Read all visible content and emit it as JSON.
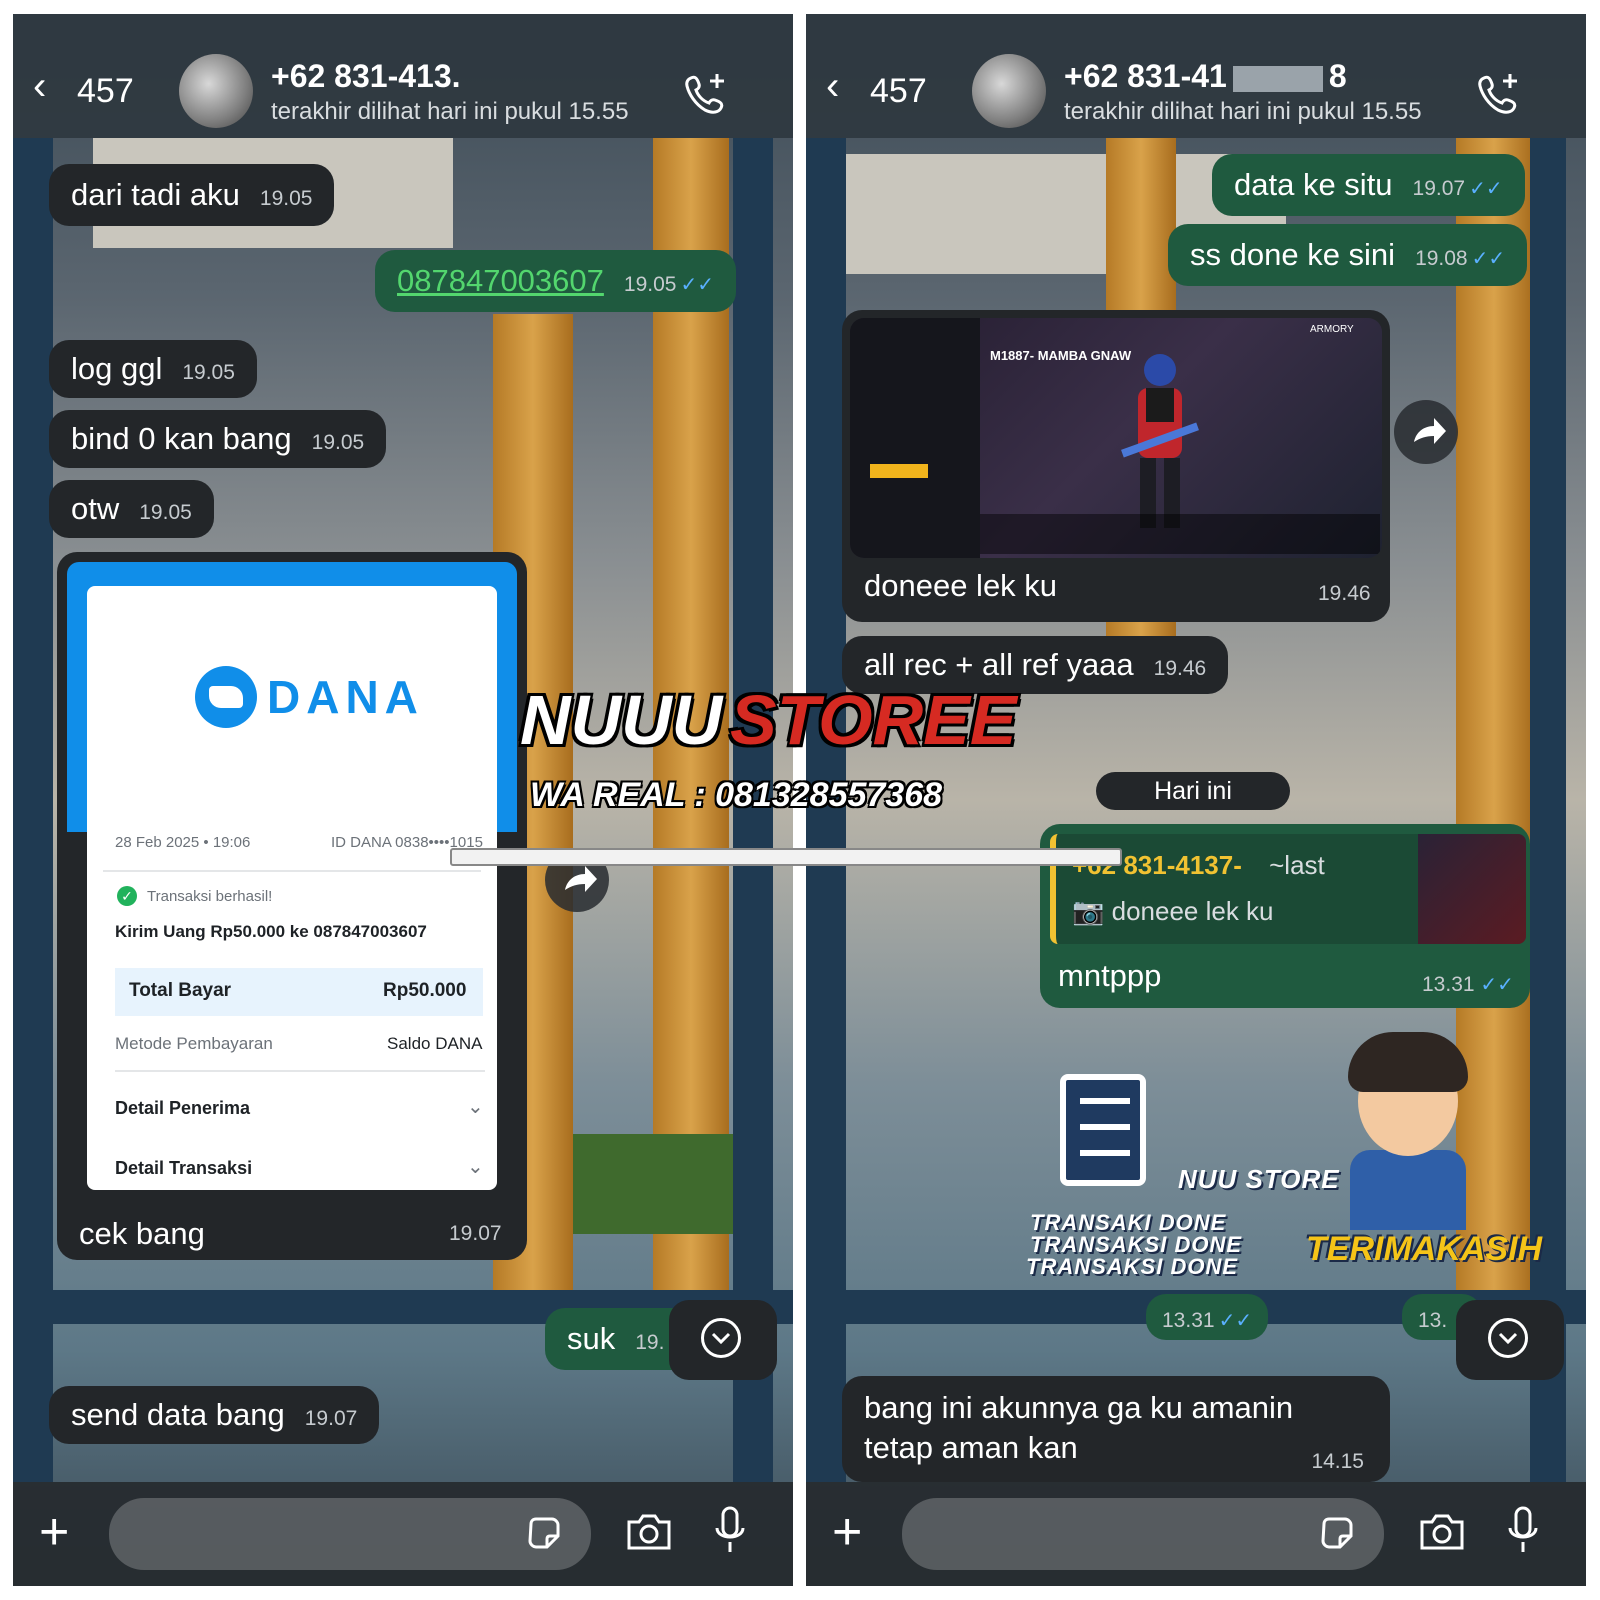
{
  "left_chat": {
    "header": {
      "back_count": "457",
      "contact_name": "+62 831-413.",
      "last_seen": "terakhir dilihat hari ini pukul 15.55"
    },
    "messages": [
      {
        "text": "dari tadi aku",
        "time": "19.05"
      },
      {
        "text": "087847003607",
        "time": "19.05"
      },
      {
        "text": "log ggl",
        "time": "19.05"
      },
      {
        "text": "bind 0 kan bang",
        "time": "19.05"
      },
      {
        "text": "otw",
        "time": "19.05"
      },
      {
        "text": "cek bang",
        "time": "19.07"
      },
      {
        "text": "suk",
        "time": "19."
      },
      {
        "text": "send data bang",
        "time": "19.07"
      }
    ],
    "receipt": {
      "brand": "DANA",
      "date": "28 Feb 2025 • 19:06",
      "dana_id": "ID DANA 0838••••1015",
      "status": "Transaksi berhasil!",
      "description": "Kirim Uang Rp50.000 ke 087847003607",
      "total_label": "Total Bayar",
      "total_value": "Rp50.000",
      "method_label": "Metode Pembayaran",
      "method_value": "Saldo DANA",
      "detail_receiver": "Detail Penerima",
      "detail_transaction": "Detail Transaksi"
    }
  },
  "right_chat": {
    "header": {
      "back_count": "457",
      "contact_name": "+62 831-41",
      "contact_name_end": "8",
      "last_seen": "terakhir dilihat hari ini pukul 15.55"
    },
    "messages": [
      {
        "text": "data ke situ",
        "time": "19.07"
      },
      {
        "text": "ss done ke sini",
        "time": "19.08"
      },
      {
        "text": "doneee lek ku",
        "time": "19.46"
      },
      {
        "text": "all rec + all ref yaaa",
        "time": "19.46"
      },
      {
        "text": "mntppp",
        "time": "13.31"
      },
      {
        "text": "13.31"
      },
      {
        "text": "13."
      },
      {
        "text": "bang ini akunnya ga ku amanin tetap aman kan",
        "time": "14.15"
      }
    ],
    "game_title": "M1887- MAMBA GNAW",
    "game_armory": "ARMORY",
    "day_separator": "Hari ini",
    "quote": {
      "author": "+62 831-4137-",
      "author_tail": "~last",
      "text": "doneee lek ku"
    },
    "sticker": {
      "line1": "TRANSAKI DONE",
      "line2": "TRANSAKSI DONE",
      "line3": "TRANSAKSI DONE",
      "thanks": "TERIMAKASIH",
      "brand": "NUU STORE"
    }
  },
  "watermark": {
    "title_part1": "NUUU",
    "title_part2": "STOREE",
    "subtitle": "WA REAL : 081328557368"
  },
  "icons": {
    "back": "chevron-left-icon",
    "call": "phone-plus-icon",
    "plus": "plus-icon",
    "sticker": "sticker-icon",
    "camera": "camera-icon",
    "mic": "microphone-icon",
    "forward": "forward-icon",
    "scroll": "chevron-down-icon"
  },
  "colors": {
    "incoming_bubble": "#232629",
    "outgoing_bubble": "#1f5a3f",
    "read_ticks": "#5ab0ff",
    "dana_blue": "#108ee9"
  }
}
